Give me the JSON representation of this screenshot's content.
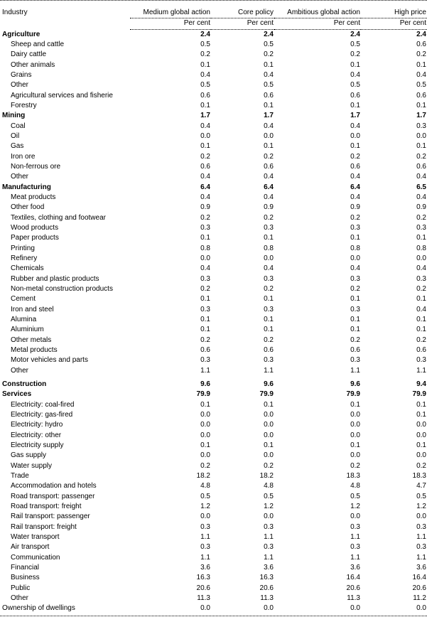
{
  "table": {
    "header": {
      "industry_label": "Industry",
      "columns": [
        "Medium global action",
        "Core policy",
        "Ambitious global action",
        "High price"
      ],
      "units": [
        "Per cent",
        "Per cent",
        "Per cent",
        "Per cent"
      ]
    },
    "rows": [
      {
        "label": "Agriculture",
        "type": "group",
        "values": [
          "2.4",
          "2.4",
          "2.4",
          "2.4"
        ]
      },
      {
        "label": "Sheep and cattle",
        "type": "sub",
        "values": [
          "0.5",
          "0.5",
          "0.5",
          "0.6"
        ]
      },
      {
        "label": "Dairy cattle",
        "type": "sub",
        "values": [
          "0.2",
          "0.2",
          "0.2",
          "0.2"
        ]
      },
      {
        "label": "Other animals",
        "type": "sub",
        "values": [
          "0.1",
          "0.1",
          "0.1",
          "0.1"
        ]
      },
      {
        "label": "Grains",
        "type": "sub",
        "values": [
          "0.4",
          "0.4",
          "0.4",
          "0.4"
        ]
      },
      {
        "label": "Other",
        "type": "sub",
        "values": [
          "0.5",
          "0.5",
          "0.5",
          "0.5"
        ]
      },
      {
        "label": "Agricultural services and fisherie",
        "type": "sub",
        "values": [
          "0.6",
          "0.6",
          "0.6",
          "0.6"
        ]
      },
      {
        "label": "Forestry",
        "type": "sub",
        "values": [
          "0.1",
          "0.1",
          "0.1",
          "0.1"
        ]
      },
      {
        "label": "Mining",
        "type": "group",
        "values": [
          "1.7",
          "1.7",
          "1.7",
          "1.7"
        ]
      },
      {
        "label": "Coal",
        "type": "sub",
        "values": [
          "0.4",
          "0.4",
          "0.4",
          "0.3"
        ]
      },
      {
        "label": "Oil",
        "type": "sub",
        "values": [
          "0.0",
          "0.0",
          "0.0",
          "0.0"
        ]
      },
      {
        "label": "Gas",
        "type": "sub",
        "values": [
          "0.1",
          "0.1",
          "0.1",
          "0.1"
        ]
      },
      {
        "label": "Iron ore",
        "type": "sub",
        "values": [
          "0.2",
          "0.2",
          "0.2",
          "0.2"
        ]
      },
      {
        "label": "Non-ferrous ore",
        "type": "sub",
        "values": [
          "0.6",
          "0.6",
          "0.6",
          "0.6"
        ]
      },
      {
        "label": "Other",
        "type": "sub",
        "values": [
          "0.4",
          "0.4",
          "0.4",
          "0.4"
        ]
      },
      {
        "label": "Manufacturing",
        "type": "group",
        "values": [
          "6.4",
          "6.4",
          "6.4",
          "6.5"
        ]
      },
      {
        "label": "Meat products",
        "type": "sub",
        "values": [
          "0.4",
          "0.4",
          "0.4",
          "0.4"
        ]
      },
      {
        "label": "Other food",
        "type": "sub",
        "values": [
          "0.9",
          "0.9",
          "0.9",
          "0.9"
        ]
      },
      {
        "label": "Textiles, clothing and footwear",
        "type": "sub",
        "values": [
          "0.2",
          "0.2",
          "0.2",
          "0.2"
        ]
      },
      {
        "label": "Wood products",
        "type": "sub",
        "values": [
          "0.3",
          "0.3",
          "0.3",
          "0.3"
        ]
      },
      {
        "label": "Paper products",
        "type": "sub",
        "values": [
          "0.1",
          "0.1",
          "0.1",
          "0.1"
        ]
      },
      {
        "label": "Printing",
        "type": "sub",
        "values": [
          "0.8",
          "0.8",
          "0.8",
          "0.8"
        ]
      },
      {
        "label": "Refinery",
        "type": "sub",
        "values": [
          "0.0",
          "0.0",
          "0.0",
          "0.0"
        ]
      },
      {
        "label": "Chemicals",
        "type": "sub",
        "values": [
          "0.4",
          "0.4",
          "0.4",
          "0.4"
        ]
      },
      {
        "label": "Rubber and plastic products",
        "type": "sub",
        "values": [
          "0.3",
          "0.3",
          "0.3",
          "0.3"
        ]
      },
      {
        "label": "Non-metal construction products",
        "type": "sub",
        "values": [
          "0.2",
          "0.2",
          "0.2",
          "0.2"
        ]
      },
      {
        "label": "Cement",
        "type": "sub",
        "values": [
          "0.1",
          "0.1",
          "0.1",
          "0.1"
        ]
      },
      {
        "label": "Iron and steel",
        "type": "sub",
        "values": [
          "0.3",
          "0.3",
          "0.3",
          "0.4"
        ]
      },
      {
        "label": "Alumina",
        "type": "sub",
        "values": [
          "0.1",
          "0.1",
          "0.1",
          "0.1"
        ]
      },
      {
        "label": "Aluminium",
        "type": "sub",
        "values": [
          "0.1",
          "0.1",
          "0.1",
          "0.1"
        ]
      },
      {
        "label": "Other metals",
        "type": "sub",
        "values": [
          "0.2",
          "0.2",
          "0.2",
          "0.2"
        ]
      },
      {
        "label": "Metal products",
        "type": "sub",
        "values": [
          "0.6",
          "0.6",
          "0.6",
          "0.6"
        ]
      },
      {
        "label": "Motor vehicles and parts",
        "type": "sub",
        "values": [
          "0.3",
          "0.3",
          "0.3",
          "0.3"
        ]
      },
      {
        "label": "Other",
        "type": "sub",
        "values": [
          "1.1",
          "1.1",
          "1.1",
          "1.1"
        ]
      },
      {
        "label": "",
        "type": "gap",
        "values": [
          "",
          "",
          "",
          ""
        ]
      },
      {
        "label": "Construction",
        "type": "group",
        "values": [
          "9.6",
          "9.6",
          "9.6",
          "9.4"
        ]
      },
      {
        "label": "Services",
        "type": "group",
        "values": [
          "79.9",
          "79.9",
          "79.9",
          "79.9"
        ]
      },
      {
        "label": "Electricity: coal-fired",
        "type": "sub",
        "values": [
          "0.1",
          "0.1",
          "0.1",
          "0.1"
        ]
      },
      {
        "label": "Electricity: gas-fired",
        "type": "sub",
        "values": [
          "0.0",
          "0.0",
          "0.0",
          "0.1"
        ]
      },
      {
        "label": "Electricity: hydro",
        "type": "sub",
        "values": [
          "0.0",
          "0.0",
          "0.0",
          "0.0"
        ]
      },
      {
        "label": "Electricity: other",
        "type": "sub",
        "values": [
          "0.0",
          "0.0",
          "0.0",
          "0.0"
        ]
      },
      {
        "label": "Electricity supply",
        "type": "sub",
        "values": [
          "0.1",
          "0.1",
          "0.1",
          "0.1"
        ]
      },
      {
        "label": "Gas supply",
        "type": "sub",
        "values": [
          "0.0",
          "0.0",
          "0.0",
          "0.0"
        ]
      },
      {
        "label": "Water supply",
        "type": "sub",
        "values": [
          "0.2",
          "0.2",
          "0.2",
          "0.2"
        ]
      },
      {
        "label": "Trade",
        "type": "sub",
        "values": [
          "18.2",
          "18.2",
          "18.3",
          "18.3"
        ]
      },
      {
        "label": "Accommodation and hotels",
        "type": "sub",
        "values": [
          "4.8",
          "4.8",
          "4.8",
          "4.7"
        ]
      },
      {
        "label": "Road transport: passenger",
        "type": "sub",
        "values": [
          "0.5",
          "0.5",
          "0.5",
          "0.5"
        ]
      },
      {
        "label": "Road transport: freight",
        "type": "sub",
        "values": [
          "1.2",
          "1.2",
          "1.2",
          "1.2"
        ]
      },
      {
        "label": "Rail transport: passenger",
        "type": "sub",
        "values": [
          "0.0",
          "0.0",
          "0.0",
          "0.0"
        ]
      },
      {
        "label": "Rail transport: freight",
        "type": "sub",
        "values": [
          "0.3",
          "0.3",
          "0.3",
          "0.3"
        ]
      },
      {
        "label": "Water transport",
        "type": "sub",
        "values": [
          "1.1",
          "1.1",
          "1.1",
          "1.1"
        ]
      },
      {
        "label": "Air transport",
        "type": "sub",
        "values": [
          "0.3",
          "0.3",
          "0.3",
          "0.3"
        ]
      },
      {
        "label": "Communication",
        "type": "sub",
        "values": [
          "1.1",
          "1.1",
          "1.1",
          "1.1"
        ]
      },
      {
        "label": "Financial",
        "type": "sub",
        "values": [
          "3.6",
          "3.6",
          "3.6",
          "3.6"
        ]
      },
      {
        "label": "Business",
        "type": "sub",
        "values": [
          "16.3",
          "16.3",
          "16.4",
          "16.4"
        ]
      },
      {
        "label": "Public",
        "type": "sub",
        "values": [
          "20.6",
          "20.6",
          "20.6",
          "20.6"
        ]
      },
      {
        "label": "Other",
        "type": "sub",
        "values": [
          "11.3",
          "11.3",
          "11.3",
          "11.2"
        ]
      },
      {
        "label": "Ownership of dwellings",
        "type": "plain",
        "values": [
          "0.0",
          "0.0",
          "0.0",
          "0.0"
        ]
      }
    ]
  }
}
